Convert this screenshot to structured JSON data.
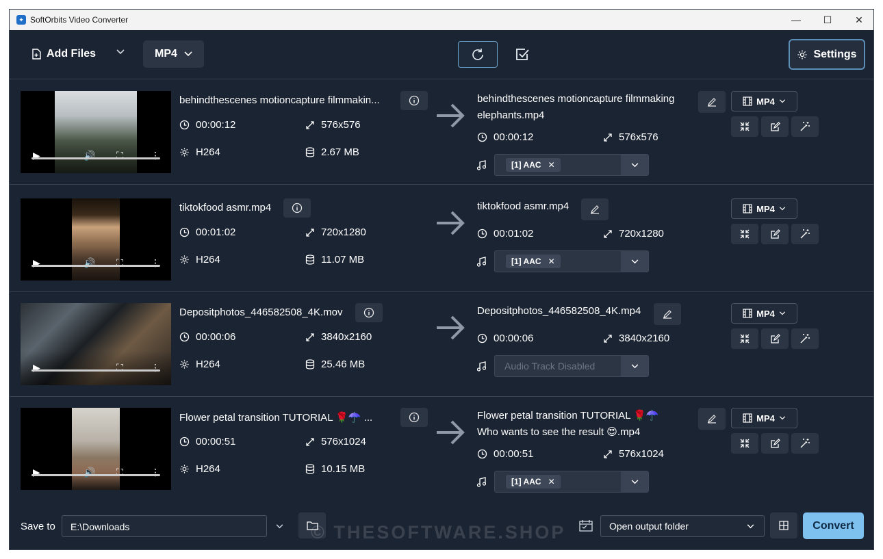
{
  "window": {
    "title": "SoftOrbits Video Converter",
    "minimize": "—",
    "maximize": "☐",
    "close": "✕"
  },
  "toolbar": {
    "add_files": "Add Files",
    "format": "MP4",
    "settings": "Settings"
  },
  "files": [
    {
      "name": "behindthescenes motioncapture filmmakin...",
      "duration": "00:00:12",
      "resolution": "576x576",
      "codec": "H264",
      "size": "2.67 MB",
      "out_name": "behindthescenes motioncapture filmmaking elephants.mp4",
      "out_duration": "00:00:12",
      "out_resolution": "576x576",
      "audio": "[1] AAC",
      "out_format": "MP4"
    },
    {
      "name": "tiktokfood asmr.mp4",
      "duration": "00:01:02",
      "resolution": "720x1280",
      "codec": "H264",
      "size": "11.07 MB",
      "out_name": "tiktokfood asmr.mp4",
      "out_duration": "00:01:02",
      "out_resolution": "720x1280",
      "audio": "[1] AAC",
      "out_format": "MP4"
    },
    {
      "name": "Depositphotos_446582508_4K.mov",
      "duration": "00:00:06",
      "resolution": "3840x2160",
      "codec": "H264",
      "size": "25.46 MB",
      "out_name": "Depositphotos_446582508_4K.mp4",
      "out_duration": "00:00:06",
      "out_resolution": "3840x2160",
      "audio_disabled": "Audio Track Disabled",
      "out_format": "MP4"
    },
    {
      "name": "Flower petal transition TUTORIAL 🌹☂️ ...",
      "duration": "00:00:51",
      "resolution": "576x1024",
      "codec": "H264",
      "size": "10.15 MB",
      "out_name": "Flower petal transition TUTORIAL 🌹☂️ Who wants to see the result 😍.mp4",
      "out_duration": "00:00:51",
      "out_resolution": "576x1024",
      "audio": "[1] AAC",
      "out_format": "MP4"
    }
  ],
  "bottom": {
    "save_to": "Save to",
    "path": "E:\\Downloads",
    "after_convert": "Open output folder",
    "convert": "Convert"
  },
  "watermark": "© THESOFTWARE.SHOP",
  "colors": {
    "background": "#1b2433",
    "panel": "#2c3544",
    "accent": "#7ec0ee"
  }
}
